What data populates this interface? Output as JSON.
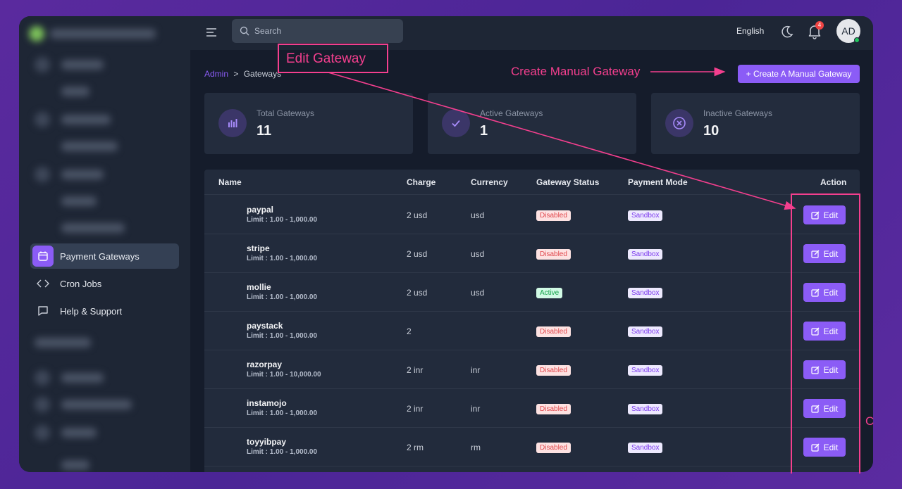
{
  "sidebar": {
    "items": [
      {
        "label": "Payment Gateways",
        "icon": "calendar-icon",
        "active": true
      },
      {
        "label": "Cron Jobs",
        "icon": "code-icon",
        "active": false
      },
      {
        "label": "Help & Support",
        "icon": "chat-icon",
        "active": false
      }
    ]
  },
  "topbar": {
    "search_placeholder": "Search",
    "language": "English",
    "notification_count": "4",
    "avatar_initials": "AD"
  },
  "breadcrumb": {
    "root": "Admin",
    "separator": ">",
    "current": "Gateways"
  },
  "create_button": "+ Create A Manual Gateway",
  "stats": [
    {
      "label": "Total Gateways",
      "value": "11",
      "icon": "bar-chart-icon"
    },
    {
      "label": "Active Gateways",
      "value": "1",
      "icon": "check-icon"
    },
    {
      "label": "Inactive Gateways",
      "value": "10",
      "icon": "x-circle-icon"
    }
  ],
  "table": {
    "columns": [
      "Name",
      "Charge",
      "Currency",
      "Gateway Status",
      "Payment Mode",
      "Action"
    ],
    "rows": [
      {
        "name": "paypal",
        "limit": "Limit : 1.00 - 1,000.00",
        "charge": "2 usd",
        "currency": "usd",
        "status": "Disabled",
        "mode": "Sandbox",
        "action": "Edit"
      },
      {
        "name": "stripe",
        "limit": "Limit : 1.00 - 1,000.00",
        "charge": "2 usd",
        "currency": "usd",
        "status": "Disabled",
        "mode": "Sandbox",
        "action": "Edit"
      },
      {
        "name": "mollie",
        "limit": "Limit : 1.00 - 1,000.00",
        "charge": "2 usd",
        "currency": "usd",
        "status": "Active",
        "mode": "Sandbox",
        "action": "Edit"
      },
      {
        "name": "paystack",
        "limit": "Limit : 1.00 - 1,000.00",
        "charge": "2",
        "currency": "",
        "status": "Disabled",
        "mode": "Sandbox",
        "action": "Edit"
      },
      {
        "name": "razorpay",
        "limit": "Limit : 1.00 - 10,000.00",
        "charge": "2 inr",
        "currency": "inr",
        "status": "Disabled",
        "mode": "Sandbox",
        "action": "Edit"
      },
      {
        "name": "instamojo",
        "limit": "Limit : 1.00 - 1,000.00",
        "charge": "2 inr",
        "currency": "inr",
        "status": "Disabled",
        "mode": "Sandbox",
        "action": "Edit"
      },
      {
        "name": "toyyibpay",
        "limit": "Limit : 1.00 - 1,000.00",
        "charge": "2 rm",
        "currency": "rm",
        "status": "Disabled",
        "mode": "Sandbox",
        "action": "Edit"
      }
    ]
  },
  "annotations": {
    "edit_gateway": "Edit Gateway",
    "create_manual_gateway": "Create Manual Gateway",
    "edge_letter": "C"
  },
  "colors": {
    "accent": "#8b5cf6",
    "annotation": "#f43f8e",
    "disabled": "#e0474c",
    "active": "#16a34a"
  }
}
